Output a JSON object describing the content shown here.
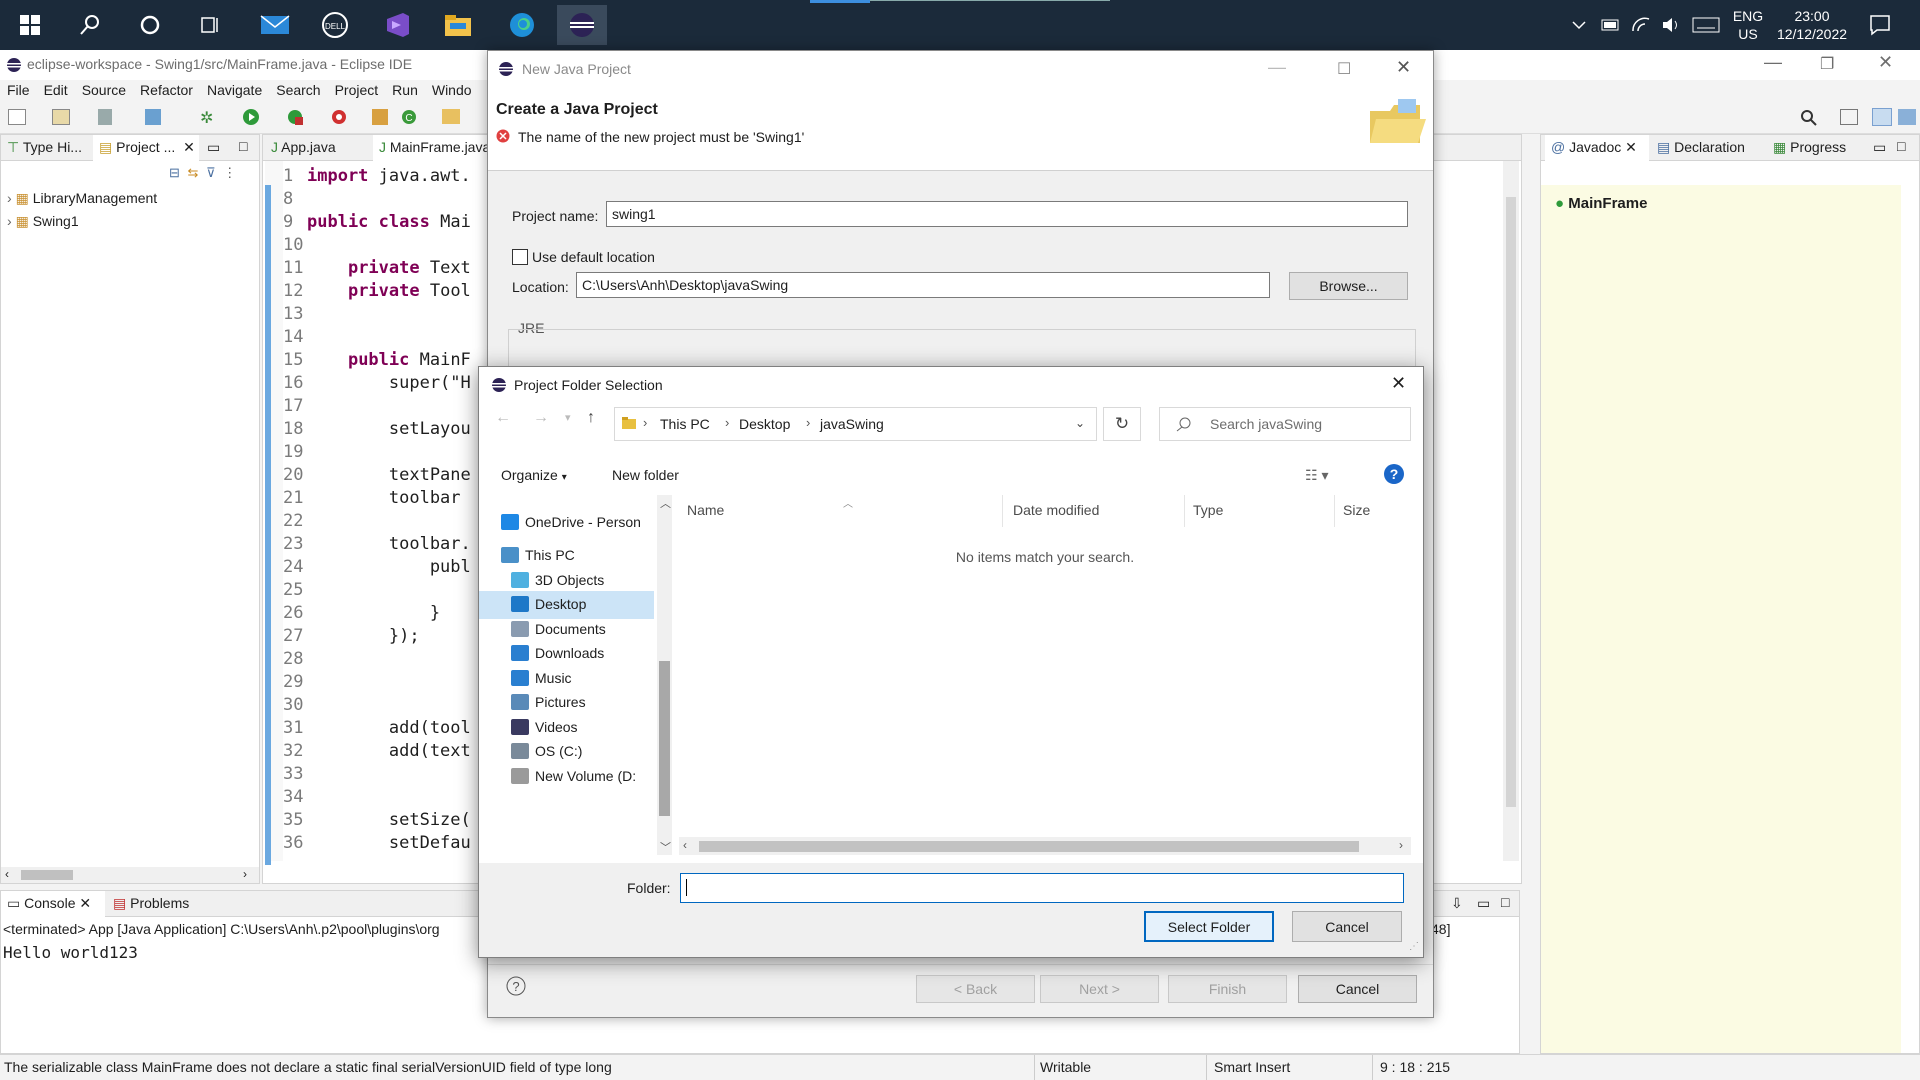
{
  "taskbar": {
    "lang_top": "ENG",
    "lang_bottom": "US",
    "time": "23:00",
    "date": "12/12/2022"
  },
  "eclipse": {
    "window_title": "eclipse-workspace - Swing1/src/MainFrame.java - Eclipse IDE",
    "menu": [
      "File",
      "Edit",
      "Source",
      "Refactor",
      "Navigate",
      "Search",
      "Project",
      "Run",
      "Windo"
    ],
    "left_tabs": [
      "Type Hi...",
      "Project ..."
    ],
    "project_tree": [
      "LibraryManagement",
      "Swing1"
    ],
    "editor_tabs": [
      "App.java",
      "MainFrame.java"
    ],
    "code_lines": [
      {
        "n": "1",
        "t": "import java.awt."
      },
      {
        "n": "8",
        "t": ""
      },
      {
        "n": "9",
        "t": "public class Mai"
      },
      {
        "n": "10",
        "t": ""
      },
      {
        "n": "11",
        "t": "    private Text"
      },
      {
        "n": "12",
        "t": "    private Tool"
      },
      {
        "n": "13",
        "t": ""
      },
      {
        "n": "14",
        "t": ""
      },
      {
        "n": "15",
        "t": "    public MainF"
      },
      {
        "n": "16",
        "t": "        super(\"H"
      },
      {
        "n": "17",
        "t": ""
      },
      {
        "n": "18",
        "t": "        setLayou"
      },
      {
        "n": "19",
        "t": ""
      },
      {
        "n": "20",
        "t": "        textPane"
      },
      {
        "n": "21",
        "t": "        toolbar "
      },
      {
        "n": "22",
        "t": ""
      },
      {
        "n": "23",
        "t": "        toolbar."
      },
      {
        "n": "24",
        "t": "            publ"
      },
      {
        "n": "25",
        "t": ""
      },
      {
        "n": "26",
        "t": "            }"
      },
      {
        "n": "27",
        "t": "        });"
      },
      {
        "n": "28",
        "t": ""
      },
      {
        "n": "29",
        "t": ""
      },
      {
        "n": "30",
        "t": ""
      },
      {
        "n": "31",
        "t": "        add(tool"
      },
      {
        "n": "32",
        "t": "        add(text"
      },
      {
        "n": "33",
        "t": ""
      },
      {
        "n": "34",
        "t": ""
      },
      {
        "n": "35",
        "t": "        setSize("
      },
      {
        "n": "36",
        "t": "        setDefau"
      }
    ],
    "right_tabs": [
      "Javadoc",
      "Declaration",
      "Progress"
    ],
    "javadoc_item": "MainFrame",
    "bottom_tabs": [
      "Console",
      "Problems"
    ],
    "console_header": "<terminated> App [Java Application] C:\\Users\\Anh\\.p2\\pool\\plugins\\org",
    "console_output": "Hello world123",
    "console_right_fragment": "48]",
    "status_message": "The serializable class MainFrame does not declare a static final serialVersionUID field of type long",
    "status_writable": "Writable",
    "status_insert": "Smart Insert",
    "status_position": "9 : 18 : 215"
  },
  "new_java_project": {
    "title": "New Java Project",
    "heading": "Create a Java Project",
    "error": "The name of the new project must be 'Swing1'",
    "project_name_label": "Project name:",
    "project_name_value": "swing1",
    "use_default_label": "Use default location",
    "location_label": "Location:",
    "location_value": "C:\\Users\\Anh\\Desktop\\javaSwing",
    "browse_label": "Browse...",
    "jre_label": "JRE",
    "back_label": "< Back",
    "next_label": "Next >",
    "finish_label": "Finish",
    "cancel_label": "Cancel"
  },
  "folder_dialog": {
    "title": "Project Folder Selection",
    "breadcrumb": [
      "This PC",
      "Desktop",
      "javaSwing"
    ],
    "search_placeholder": "Search javaSwing",
    "organize_label": "Organize",
    "new_folder_label": "New folder",
    "nav_items": [
      {
        "label": "OneDrive - Person",
        "icon": "cloud-icon",
        "color": "#1e88e5"
      },
      {
        "label": "This PC",
        "icon": "computer-icon",
        "color": "#4a90c8"
      },
      {
        "label": "3D Objects",
        "icon": "cube-icon",
        "color": "#4fb0e0"
      },
      {
        "label": "Desktop",
        "icon": "desktop-icon",
        "color": "#1e78c8"
      },
      {
        "label": "Documents",
        "icon": "document-icon",
        "color": "#8a9bb0"
      },
      {
        "label": "Downloads",
        "icon": "download-icon",
        "color": "#2a7fd0"
      },
      {
        "label": "Music",
        "icon": "music-icon",
        "color": "#2a7fd0"
      },
      {
        "label": "Pictures",
        "icon": "pictures-icon",
        "color": "#5a8ab8"
      },
      {
        "label": "Videos",
        "icon": "video-icon",
        "color": "#3a3a60"
      },
      {
        "label": "OS (C:)",
        "icon": "drive-icon",
        "color": "#7a8a9a"
      },
      {
        "label": "New Volume (D:",
        "icon": "drive-icon",
        "color": "#9a9a9a"
      }
    ],
    "columns": [
      "Name",
      "Date modified",
      "Type",
      "Size"
    ],
    "empty_message": "No items match your search.",
    "folder_label": "Folder:",
    "folder_value": "",
    "select_label": "Select Folder",
    "cancel_label": "Cancel"
  }
}
